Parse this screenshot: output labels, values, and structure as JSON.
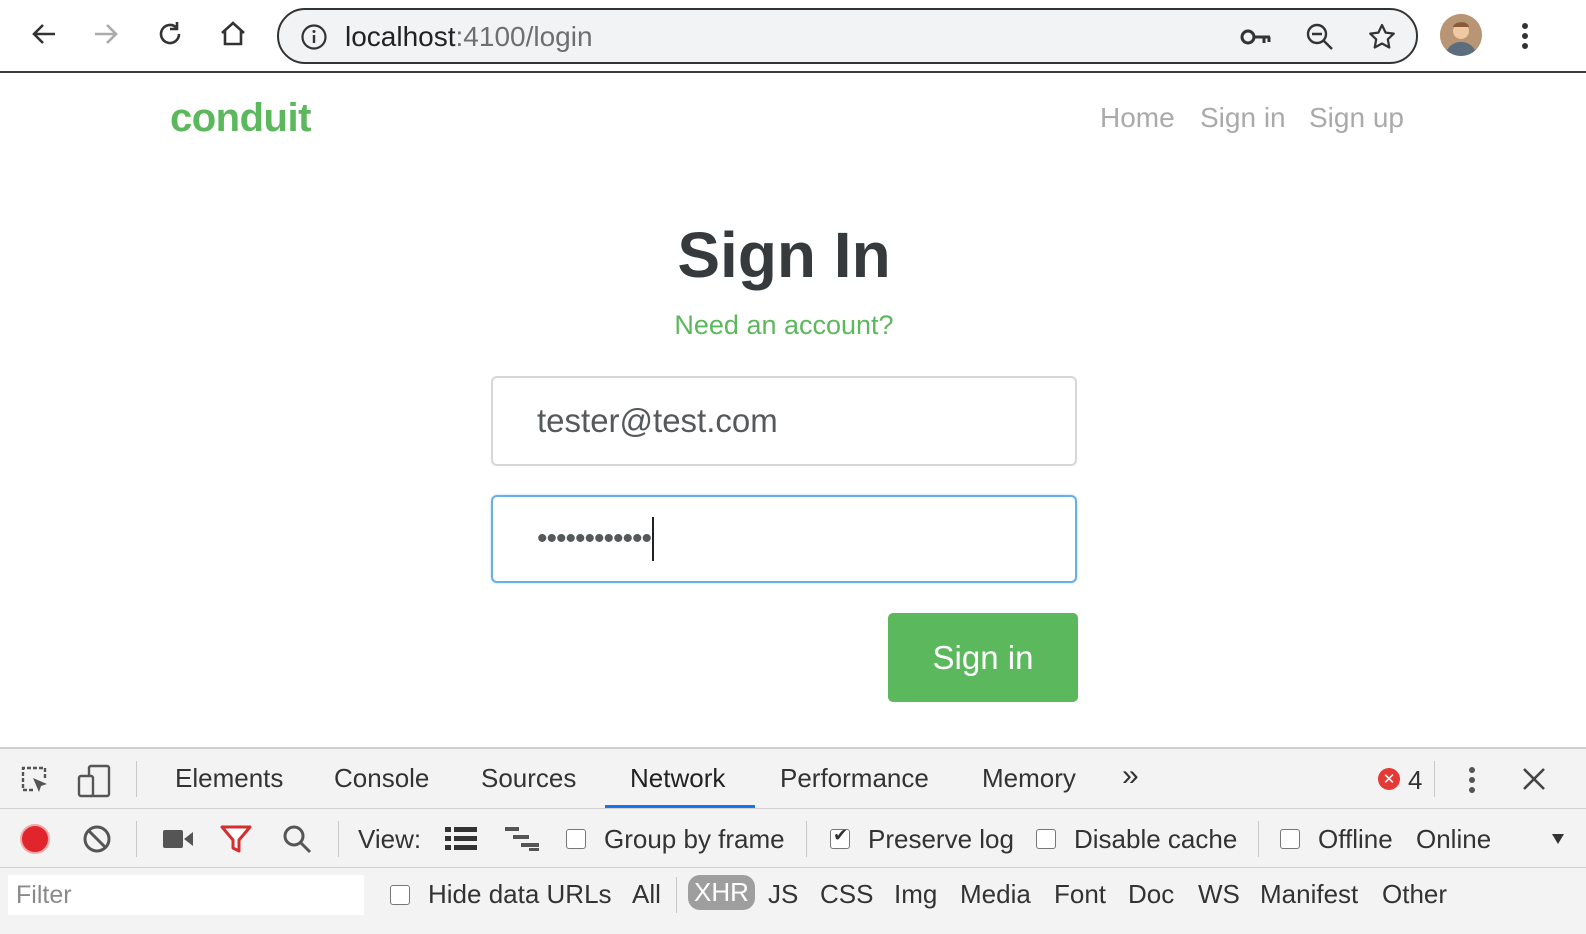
{
  "browser": {
    "url_host": "localhost",
    "url_path": ":4100/login"
  },
  "app": {
    "brand": "conduit",
    "nav": [
      "Home",
      "Sign in",
      "Sign up"
    ]
  },
  "login": {
    "title": "Sign In",
    "need_account": "Need an account?",
    "email_value": "tester@test.com",
    "password_masked": "••••••••••••",
    "submit_label": "Sign in"
  },
  "devtools": {
    "tabs": [
      "Elements",
      "Console",
      "Sources",
      "Network",
      "Performance",
      "Memory"
    ],
    "active_tab": "Network",
    "more_tabs": "»",
    "error_count": "4",
    "view_label": "View:",
    "group_by_frame": "Group by frame",
    "preserve_log": "Preserve log",
    "disable_cache": "Disable cache",
    "offline": "Offline",
    "throttle": "Online",
    "filter_placeholder": "Filter",
    "hide_data_urls": "Hide data URLs",
    "types": [
      "All",
      "XHR",
      "JS",
      "CSS",
      "Img",
      "Media",
      "Font",
      "Doc",
      "WS",
      "Manifest",
      "Other"
    ],
    "selected_type": "XHR"
  },
  "colors": {
    "brand_green": "#5cb85c",
    "focus_blue": "#66afe9",
    "active_tab_blue": "#1a73e8",
    "record_red": "#e0262c"
  }
}
